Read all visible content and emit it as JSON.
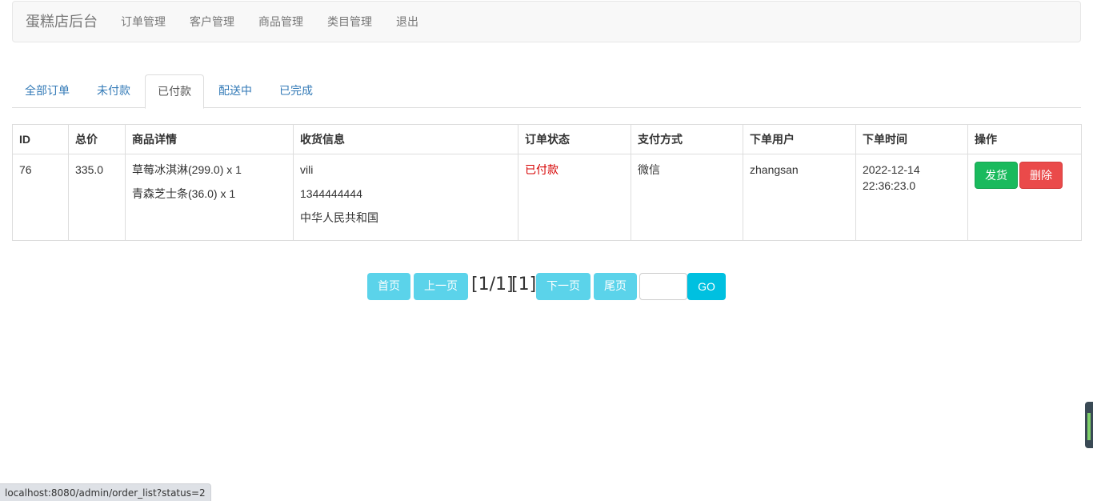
{
  "navbar": {
    "brand": "蛋糕店后台",
    "links": [
      "订单管理",
      "客户管理",
      "商品管理",
      "类目管理",
      "退出"
    ]
  },
  "tabs": [
    {
      "label": "全部订单",
      "active": false
    },
    {
      "label": "未付款",
      "active": false
    },
    {
      "label": "已付款",
      "active": true
    },
    {
      "label": "配送中",
      "active": false
    },
    {
      "label": "已完成",
      "active": false
    }
  ],
  "table": {
    "headers": [
      "ID",
      "总价",
      "商品详情",
      "收货信息",
      "订单状态",
      "支付方式",
      "下单用户",
      "下单时间",
      "操作"
    ],
    "rows": [
      {
        "id": "76",
        "total": "335.0",
        "items": [
          "草莓冰淇淋(299.0) x 1",
          "青森芝士条(36.0) x 1"
        ],
        "shipping": [
          "vili",
          "1344444444",
          "中华人民共和国"
        ],
        "status": "已付款",
        "payment": "微信",
        "user": "zhangsan",
        "time": [
          "2022-12-14",
          "22:36:23.0"
        ],
        "actions": {
          "ship": "发货",
          "delete": "删除"
        }
      }
    ]
  },
  "pagination": {
    "first": "首页",
    "prev": "上一页",
    "page_info": "[1/1]",
    "current": "[1]",
    "next": "下一页",
    "last": "尾页",
    "input_value": "",
    "go": "GO"
  },
  "statusbar": {
    "url": "localhost:8080/admin/order_list?status=2"
  },
  "colors": {
    "link": "#337ab7",
    "status_paid": "#d60000",
    "ship_button": "#1aba5d",
    "delete_button": "#ea4a4a",
    "pager_button": "#5bd3ea",
    "go_button": "#00c0e0"
  }
}
